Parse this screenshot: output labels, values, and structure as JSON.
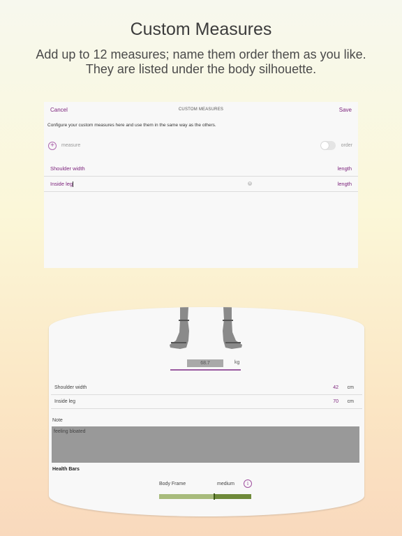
{
  "promo": {
    "title": "Custom Measures",
    "subtitle": "Add up to 12 measures; name them order them as you like. They are listed under the body silhouette."
  },
  "editor": {
    "cancel": "Cancel",
    "title": "CUSTOM MEASURES",
    "save": "Save",
    "description": "Configure your custom measures here and use them in the same way as the others.",
    "add_label": "measure",
    "order_label": "order",
    "measures": [
      {
        "name": "Shoulder width",
        "type": "length"
      },
      {
        "name": "Inside leg",
        "type": "length"
      }
    ]
  },
  "entry": {
    "weight_value": "68.7",
    "weight_unit": "kg",
    "measures": [
      {
        "name": "Shoulder width",
        "value": "42",
        "unit": "cm"
      },
      {
        "name": "Inside leg",
        "value": "70",
        "unit": "cm"
      }
    ],
    "note_label": "Note",
    "note_text": "feeling bloated",
    "health_bars_label": "Health Bars",
    "body_frame_label": "Body Frame",
    "body_frame_value": "medium",
    "body_frame_level": 0.6,
    "colors": {
      "accent": "#7a1f7a",
      "bar_light": "#a8bb7c",
      "bar_dark": "#6f8a3a"
    }
  }
}
